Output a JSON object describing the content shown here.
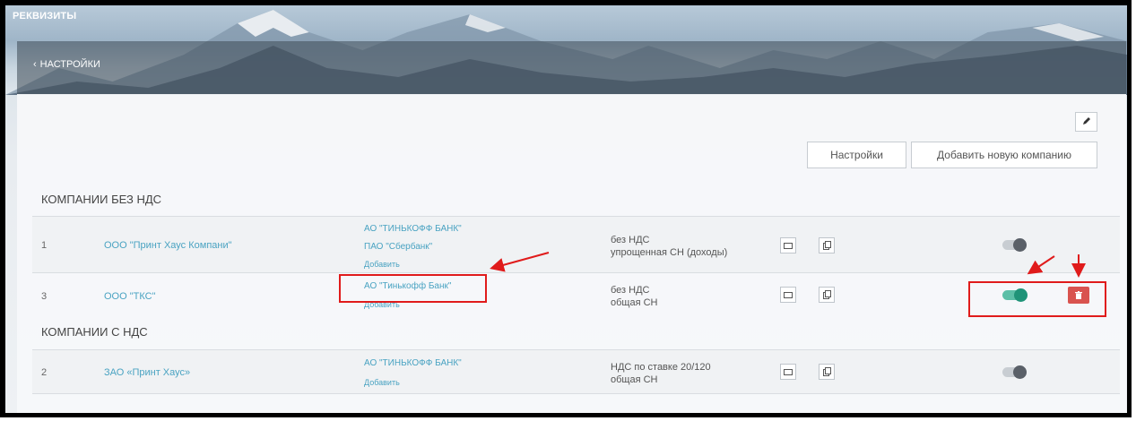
{
  "header": {
    "title": "РЕКВИЗИТЫ",
    "back_label": "НАСТРОЙКИ"
  },
  "toolbar": {
    "settings_label": "Настройки",
    "add_company_label": "Добавить новую компанию"
  },
  "sections": {
    "no_vat_title": "КОМПАНИИ БЕЗ НДС",
    "vat_title": "КОМПАНИИ С НДС"
  },
  "rows": [
    {
      "num": "1",
      "company": "ООО \"Принт Хаус Компани\"",
      "banks": [
        "АО \"ТИНЬКОФФ БАНК\"",
        "ПАО \"Сбербанк\""
      ],
      "add_label": "Добавить",
      "tax": [
        "без НДС",
        "упрощенная СН (доходы)"
      ],
      "active": false
    },
    {
      "num": "3",
      "company": "ООО \"ТКС\"",
      "banks": [
        "АО \"Тинькофф Банк\""
      ],
      "add_label": "Добавить",
      "tax": [
        "без НДС",
        "общая СН"
      ],
      "active": true
    },
    {
      "num": "2",
      "company": "ЗАО «Принт Хаус»",
      "banks": [
        "АО \"ТИНЬКОФФ БАНК\""
      ],
      "add_label": "Добавить",
      "tax": [
        "НДС по ставке 20/120",
        "общая СН"
      ],
      "active": false
    }
  ],
  "colors": {
    "link": "#4aa3c2",
    "toggle_on": "#1f9378",
    "delete": "#d9534f",
    "annotation": "#e01b1b"
  }
}
